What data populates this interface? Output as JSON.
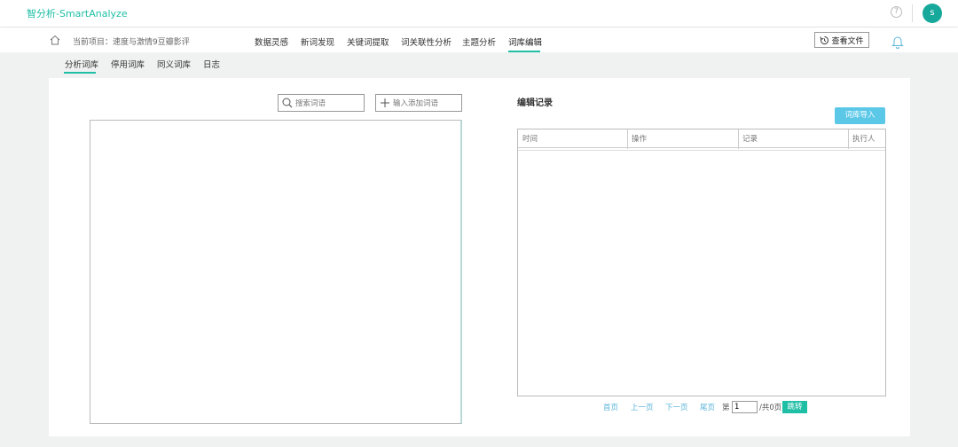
{
  "app": {
    "brand": "智分析-SmartAnalyze",
    "help": "?",
    "avatar_letter": "s"
  },
  "nav": {
    "project_label": "当前项目：速度与激情9豆瓣影评",
    "tabs": [
      {
        "label": "数据灵感"
      },
      {
        "label": "新词发现"
      },
      {
        "label": "关键词提取"
      },
      {
        "label": "词关联性分析"
      },
      {
        "label": "主题分析"
      },
      {
        "label": "词库编辑",
        "active": true
      }
    ],
    "file_button": "查看文件"
  },
  "subtabs": [
    {
      "label": "分析词库",
      "active": true
    },
    {
      "label": "停用词库"
    },
    {
      "label": "同义词库"
    },
    {
      "label": "日志"
    }
  ],
  "left": {
    "search_placeholder": "搜索词语",
    "add_placeholder": "输入添加词语"
  },
  "right": {
    "title": "编辑记录",
    "import_button": "词库导入",
    "columns": [
      "时间",
      "操作",
      "记录",
      "执行人"
    ]
  },
  "pager": {
    "first": "首页",
    "prev": "上一页",
    "next": "下一页",
    "last": "尾页",
    "page_prefix": "第",
    "page_value": "1",
    "total": "/共0页",
    "jump": "跳转"
  },
  "colors": {
    "accent": "#1fbfa5",
    "import": "#5bc8e8",
    "link": "#5bb5d9"
  }
}
